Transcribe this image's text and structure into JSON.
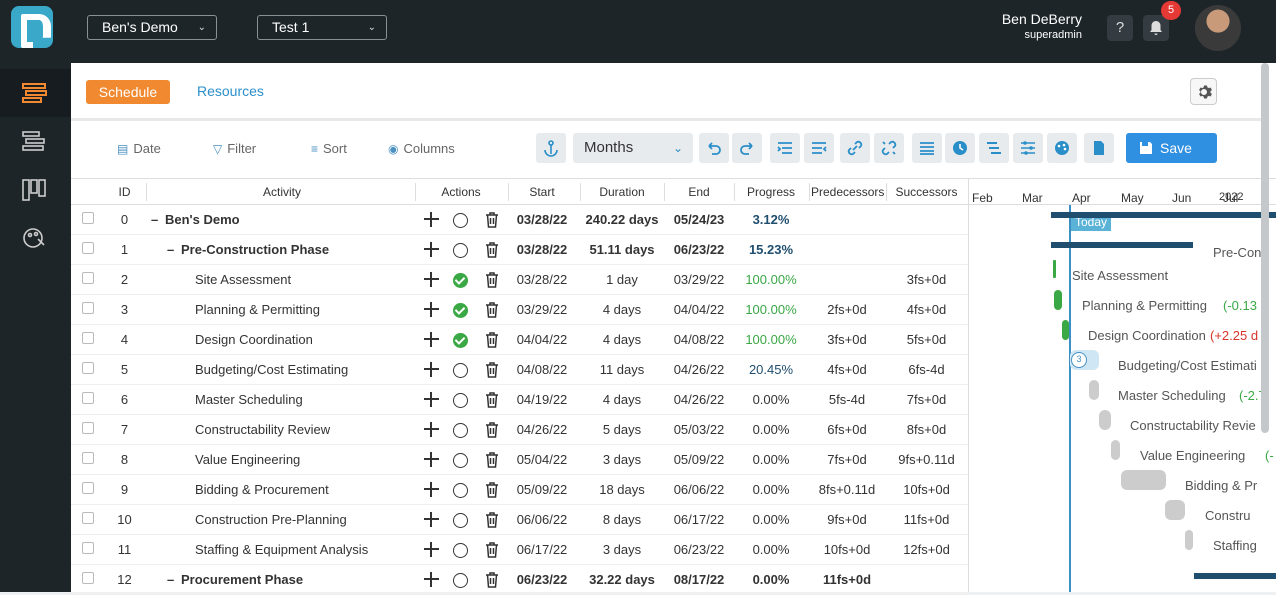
{
  "header": {
    "project_dropdown": "Ben's Demo",
    "schedule_dropdown": "Test 1",
    "user_name": "Ben DeBerry",
    "user_role": "superadmin",
    "help_label": "?",
    "notification_count": "5"
  },
  "tabs": {
    "schedule": "Schedule",
    "resources": "Resources"
  },
  "toolbar": {
    "date": "Date",
    "filter": "Filter",
    "sort": "Sort",
    "columns": "Columns",
    "timescale": "Months",
    "save": "Save"
  },
  "columns": {
    "id": "ID",
    "activity": "Activity",
    "actions": "Actions",
    "start": "Start",
    "duration": "Duration",
    "end": "End",
    "progress": "Progress",
    "predecessors": "Predecessors",
    "successors": "Successors"
  },
  "rows": [
    {
      "id": "0",
      "collapse": "–",
      "activity": "Ben's Demo",
      "start": "03/28/22",
      "duration": "240.22 days",
      "end": "05/24/23",
      "progress": "3.12%",
      "pred": "",
      "succ": "",
      "summary": true,
      "level": 0,
      "done": false,
      "progress_color": "#1f4e6e"
    },
    {
      "id": "1",
      "collapse": "–",
      "activity": "Pre-Construction Phase",
      "start": "03/28/22",
      "duration": "51.11 days",
      "end": "06/23/22",
      "progress": "15.23%",
      "pred": "",
      "succ": "",
      "summary": true,
      "level": 1,
      "done": false,
      "progress_color": "#1f4e6e"
    },
    {
      "id": "2",
      "collapse": "",
      "activity": "Site Assessment",
      "start": "03/28/22",
      "duration": "1 day",
      "end": "03/29/22",
      "progress": "100.00%",
      "pred": "",
      "succ": "3fs+0d",
      "summary": false,
      "level": 2,
      "done": true,
      "progress_color": "#3aa844"
    },
    {
      "id": "3",
      "collapse": "",
      "activity": "Planning & Permitting",
      "start": "03/29/22",
      "duration": "4 days",
      "end": "04/04/22",
      "progress": "100.00%",
      "pred": "2fs+0d",
      "succ": "4fs+0d",
      "summary": false,
      "level": 2,
      "done": true,
      "progress_color": "#3aa844"
    },
    {
      "id": "4",
      "collapse": "",
      "activity": "Design Coordination",
      "start": "04/04/22",
      "duration": "4 days",
      "end": "04/08/22",
      "progress": "100.00%",
      "pred": "3fs+0d",
      "succ": "5fs+0d",
      "summary": false,
      "level": 2,
      "done": true,
      "progress_color": "#3aa844"
    },
    {
      "id": "5",
      "collapse": "",
      "activity": "Budgeting/Cost Estimating",
      "start": "04/08/22",
      "duration": "11 days",
      "end": "04/26/22",
      "progress": "20.45%",
      "pred": "4fs+0d",
      "succ": "6fs-4d",
      "summary": false,
      "level": 2,
      "done": false,
      "progress_color": "#1f4e6e"
    },
    {
      "id": "6",
      "collapse": "",
      "activity": "Master Scheduling",
      "start": "04/19/22",
      "duration": "4 days",
      "end": "04/26/22",
      "progress": "0.00%",
      "pred": "5fs-4d",
      "succ": "7fs+0d",
      "summary": false,
      "level": 2,
      "done": false,
      "progress_color": "#333"
    },
    {
      "id": "7",
      "collapse": "",
      "activity": "Constructability Review",
      "start": "04/26/22",
      "duration": "5 days",
      "end": "05/03/22",
      "progress": "0.00%",
      "pred": "6fs+0d",
      "succ": "8fs+0d",
      "summary": false,
      "level": 2,
      "done": false,
      "progress_color": "#333"
    },
    {
      "id": "8",
      "collapse": "",
      "activity": "Value Engineering",
      "start": "05/04/22",
      "duration": "3 days",
      "end": "05/09/22",
      "progress": "0.00%",
      "pred": "7fs+0d",
      "succ": "9fs+0.11d",
      "summary": false,
      "level": 2,
      "done": false,
      "progress_color": "#333"
    },
    {
      "id": "9",
      "collapse": "",
      "activity": "Bidding & Procurement",
      "start": "05/09/22",
      "duration": "18 days",
      "end": "06/06/22",
      "progress": "0.00%",
      "pred": "8fs+0.11d",
      "succ": "10fs+0d",
      "summary": false,
      "level": 2,
      "done": false,
      "progress_color": "#333"
    },
    {
      "id": "10",
      "collapse": "",
      "activity": "Construction Pre-Planning",
      "start": "06/06/22",
      "duration": "8 days",
      "end": "06/17/22",
      "progress": "0.00%",
      "pred": "9fs+0d",
      "succ": "11fs+0d",
      "summary": false,
      "level": 2,
      "done": false,
      "progress_color": "#333"
    },
    {
      "id": "11",
      "collapse": "",
      "activity": "Staffing & Equipment Analysis",
      "start": "06/17/22",
      "duration": "3 days",
      "end": "06/23/22",
      "progress": "0.00%",
      "pred": "10fs+0d",
      "succ": "12fs+0d",
      "summary": false,
      "level": 2,
      "done": false,
      "progress_color": "#333"
    },
    {
      "id": "12",
      "collapse": "–",
      "activity": "Procurement Phase",
      "start": "06/23/22",
      "duration": "32.22 days",
      "end": "08/17/22",
      "progress": "0.00%",
      "pred": "11fs+0d",
      "succ": "",
      "summary": true,
      "level": 1,
      "done": false,
      "progress_color": "#333"
    }
  ],
  "gantt": {
    "year": "2022",
    "months": [
      "Feb",
      "Mar",
      "Apr",
      "May",
      "Jun",
      "Jul"
    ],
    "today_label": "Today",
    "badge_count": "3",
    "labels": [
      "Pre-Con",
      "Site Assessment",
      "Planning & Permitting",
      "(-0.13 d",
      "Design Coordination",
      "(+2.25 d",
      "Budgeting/Cost Estimati",
      "Master Scheduling",
      "(-2.7",
      "Constructability Revie",
      "Value Engineering",
      "(-",
      "Bidding & Pr",
      "Constru",
      "Staffing"
    ]
  }
}
